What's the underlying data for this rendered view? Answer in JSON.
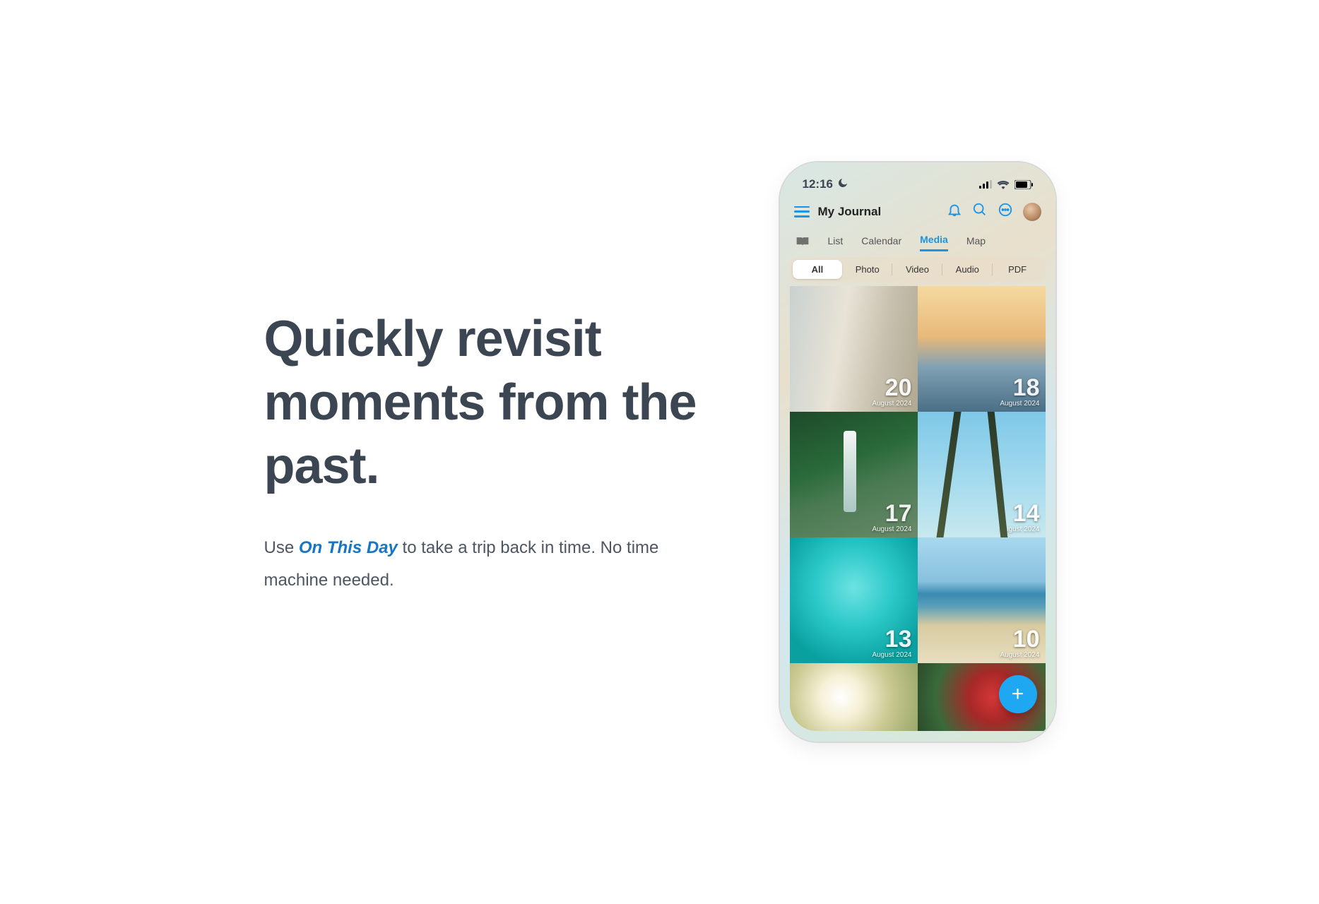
{
  "hero": {
    "heading": "Quickly revisit moments from the past.",
    "subtext_prefix": "Use ",
    "subtext_highlight": "On This Day",
    "subtext_suffix": " to take a trip back in time. No time machine needed."
  },
  "phone": {
    "status": {
      "time": "12:16"
    },
    "header": {
      "title": "My Journal"
    },
    "tabs": [
      "List",
      "Calendar",
      "Media",
      "Map"
    ],
    "active_tab": "Media",
    "filters": [
      "All",
      "Photo",
      "Video",
      "Audio",
      "PDF"
    ],
    "active_filter": "All",
    "media": [
      {
        "day": "20",
        "month": "August 2024",
        "name": "surfboards"
      },
      {
        "day": "18",
        "month": "August 2024",
        "name": "paddleboard"
      },
      {
        "day": "17",
        "month": "August 2024",
        "name": "waterfall"
      },
      {
        "day": "14",
        "month": "August 2024",
        "name": "palms"
      },
      {
        "day": "13",
        "month": "August 2024",
        "name": "snorkel"
      },
      {
        "day": "10",
        "month": "August 2024",
        "name": "beach"
      },
      {
        "day": "",
        "month": "",
        "name": "flower"
      },
      {
        "day": "",
        "month": "",
        "name": "fruit"
      }
    ],
    "fab_label": "+"
  }
}
